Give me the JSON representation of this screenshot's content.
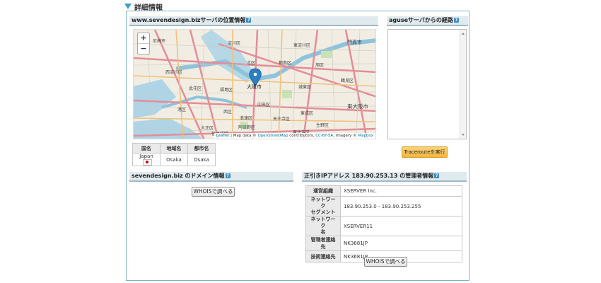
{
  "section_title": "詳細情報",
  "location": {
    "heading": "www.sevendesign.bizサーバの位置情報",
    "help": "?",
    "map": {
      "zoom_in": "+",
      "zoom_out": "−",
      "labels": [
        "尼崎市",
        "西淀川区",
        "淀川区",
        "東淀川区",
        "北区",
        "旭区",
        "門真市",
        "都島区",
        "鶴見区",
        "福島区",
        "大阪市",
        "城東区",
        "港区",
        "西区",
        "中央区",
        "東成区",
        "東大阪市",
        "大正区",
        "浪速区",
        "天王寺区",
        "生野区",
        "住之江区",
        "阿倍野区",
        "東住吉区",
        "此花区"
      ],
      "attribution": {
        "leaflet": "Leaflet",
        "sep1": " | Map data © ",
        "osm": "OpenStreetMap",
        "mid": " contributors, ",
        "cc": "CC-BY-SA",
        "mid2": ", Imagery © ",
        "mapbox": "Mapbox"
      }
    },
    "table": {
      "headers": [
        "国名",
        "地域名",
        "都市名"
      ],
      "country": "Japan",
      "region": "Osaka",
      "city": "Osaka"
    }
  },
  "route": {
    "heading": "aguseサーバからの経路",
    "help": "?",
    "button": "Tracerouteを実行"
  },
  "domain": {
    "heading": "sevendesign.biz のドメイン情報",
    "help": "?",
    "button": "WHOISで調べる"
  },
  "ip": {
    "heading": "正引きIPアドレス 183.90.253.13 の管理者情報",
    "help": "?",
    "rows": [
      {
        "label": "運営組織",
        "value": "XSERVER Inc."
      },
      {
        "label": "ネットワーク\nセグメント",
        "value": "183.90.253.0 - 183.90.253.255"
      },
      {
        "label": "ネットワーク\n名",
        "value": "XSERVER11"
      },
      {
        "label": "管理者連絡先",
        "value": "NK3681JP"
      },
      {
        "label": "技術連絡先",
        "value": "NK3681JP"
      }
    ],
    "button": "WHOISで調べる"
  },
  "colors": {
    "accent": "#3aa0c8",
    "header_bg": "#e1eaee",
    "button_orange": "#f4b63c",
    "marker": "#2c7fc0"
  }
}
